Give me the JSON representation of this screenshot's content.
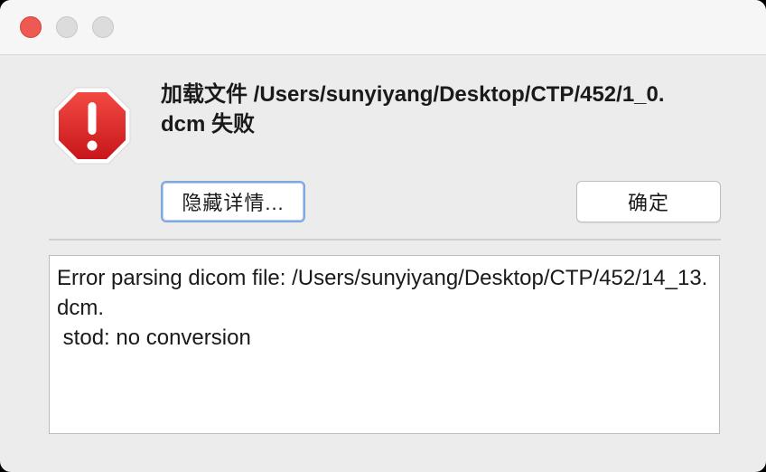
{
  "dialog": {
    "message": "加载文件 /Users/sunyiyang/Desktop/CTP/452/1_0.dcm 失败",
    "hide_details_label": "隐藏详情...",
    "ok_label": "确定",
    "details_text": "Error parsing dicom file: /Users/sunyiyang/Desktop/CTP/452/14_13.dcm.\n stod: no conversion",
    "icon": "alert-stop-icon"
  },
  "colors": {
    "close_light": "#ee5a52",
    "inactive_light": "#dcdcdc",
    "alert_red": "#d8201f",
    "focus_border": "#7fa8e0"
  }
}
